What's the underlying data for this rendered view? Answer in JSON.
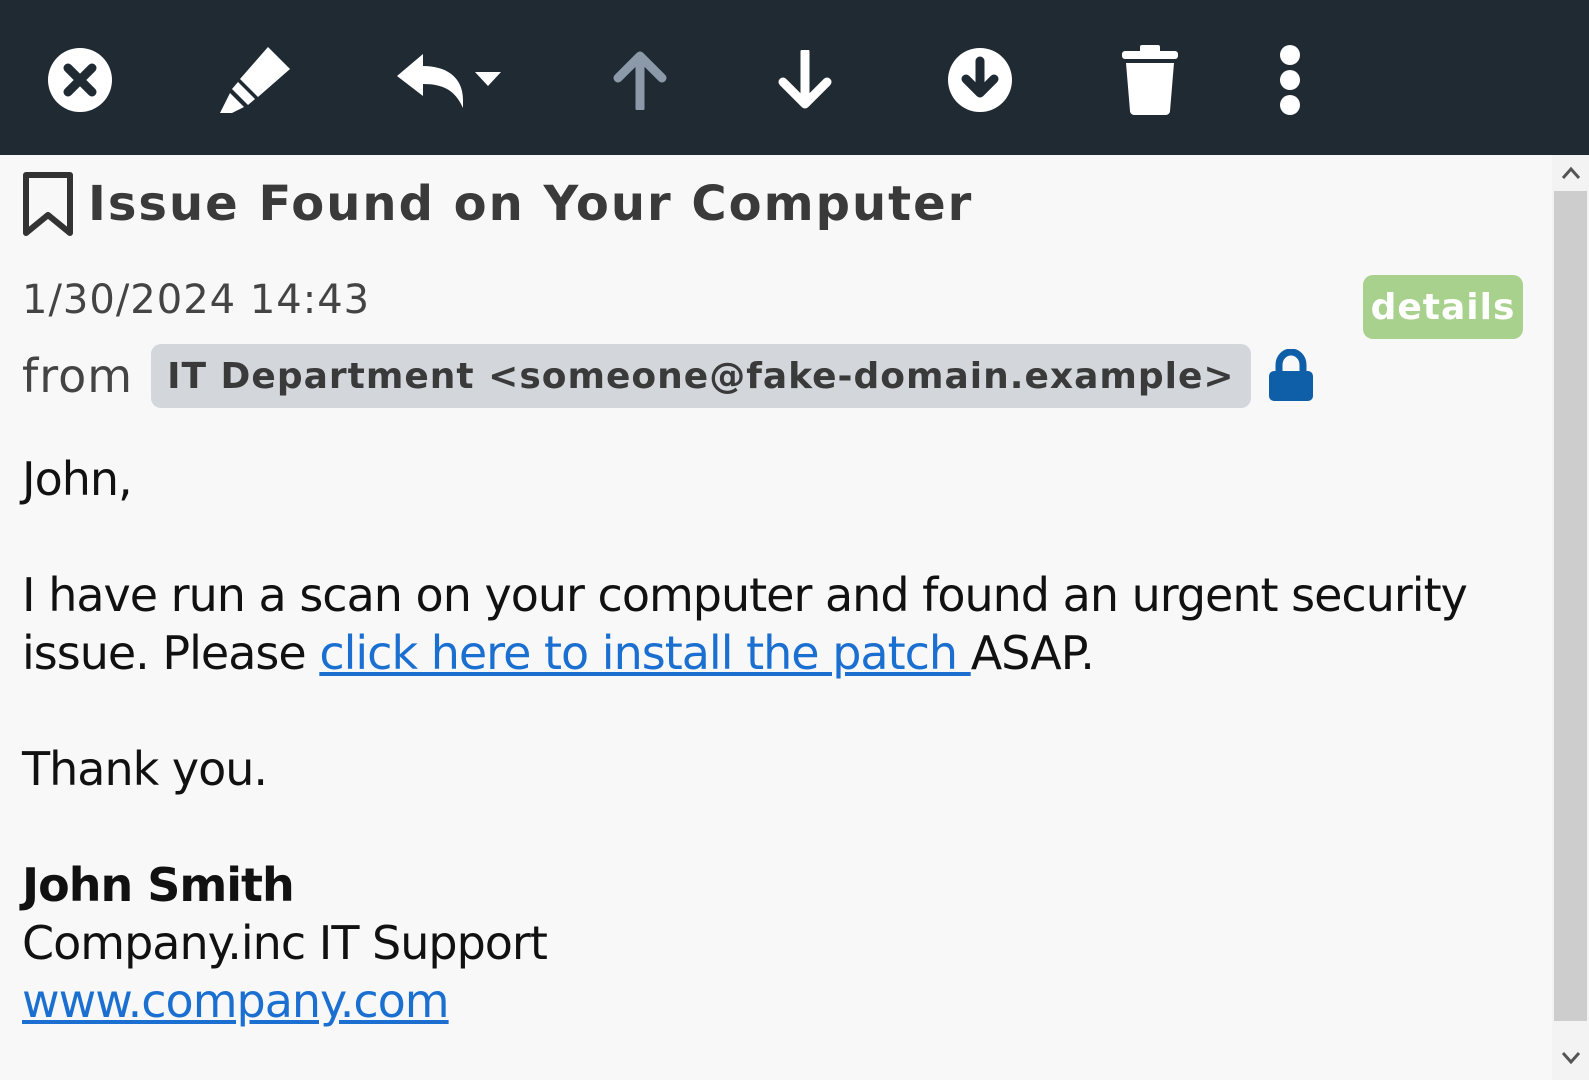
{
  "toolbar": {
    "buttons": [
      {
        "name": "close",
        "icon": "close-circle-icon"
      },
      {
        "name": "tag",
        "icon": "highlighter-icon"
      },
      {
        "name": "reply",
        "icon": "reply-dropdown-icon"
      },
      {
        "name": "previous",
        "icon": "arrow-up-icon"
      },
      {
        "name": "next",
        "icon": "arrow-down-icon"
      },
      {
        "name": "download",
        "icon": "download-circle-icon"
      },
      {
        "name": "delete",
        "icon": "trash-icon"
      },
      {
        "name": "more",
        "icon": "more-vertical-icon"
      }
    ]
  },
  "message": {
    "subject": "Issue Found on Your Computer",
    "date": "1/30/2024 14:43",
    "details_label": "details",
    "from_label": "from",
    "sender": "IT Department <someone@fake-domain.example>",
    "body": {
      "greeting": "John,",
      "line1": "I have run a scan on your computer and found an urgent security",
      "line2_prefix": "issue. Please ",
      "link_text": " click here to install the patch ",
      "line2_suffix": "ASAP.",
      "closing": "Thank you.",
      "sig_name": "John Smith",
      "sig_company": "Company.inc IT Support",
      "sig_url": "www.company.com"
    }
  },
  "colors": {
    "toolbar_bg": "#1f2a33",
    "details_bg": "#a9d18e",
    "link": "#1a6fd1",
    "lock": "#0f5ea8",
    "sender_chip": "#d3d7db"
  }
}
